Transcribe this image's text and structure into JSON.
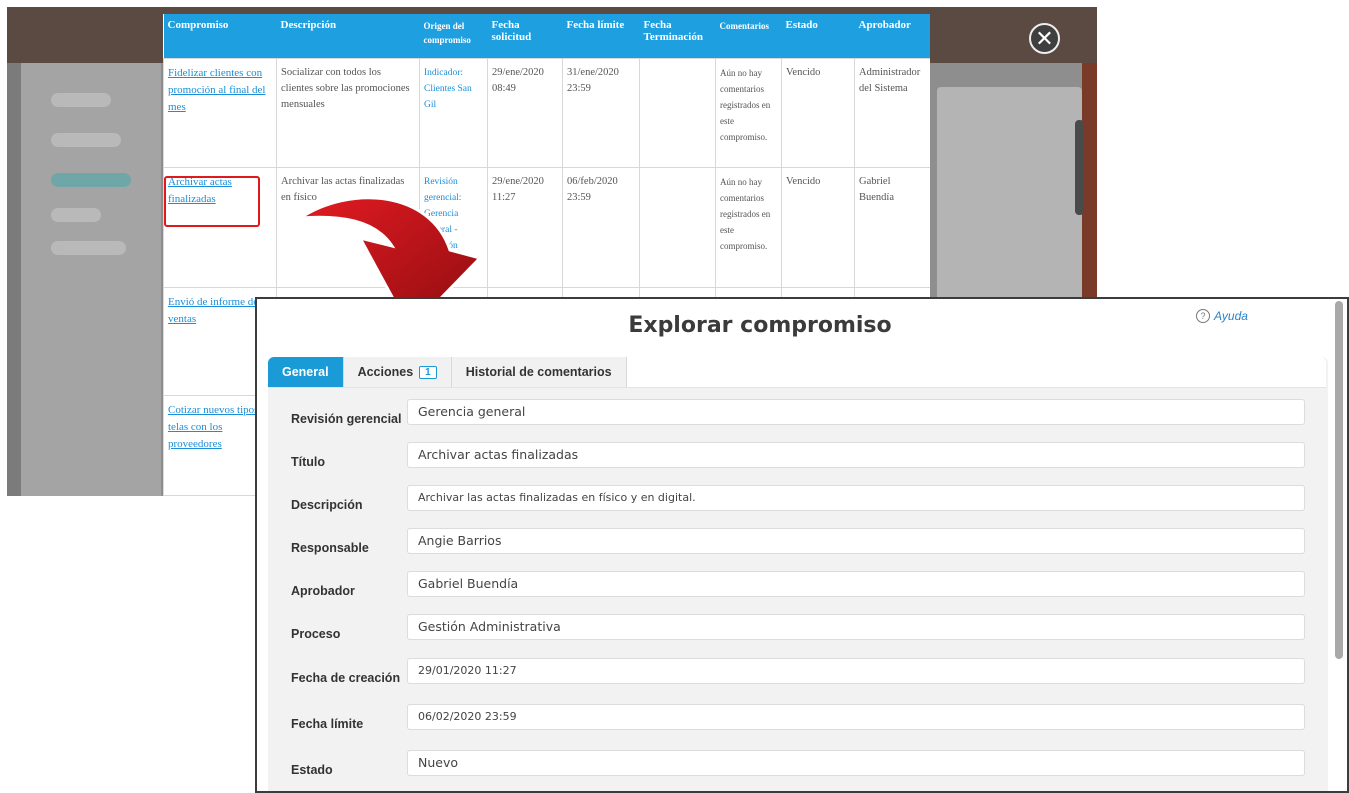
{
  "table": {
    "headers": [
      "Compromiso",
      "Descripción",
      "Origen del compromiso",
      "Fecha solicitud",
      "Fecha límite",
      "Fecha Terminación",
      "Comentarios",
      "Estado",
      "Aprobador"
    ],
    "rows": [
      {
        "compromiso": "Fidelizar clientes con promoción al final del mes",
        "descripcion": "Socializar con todos los clientes sobre las promociones mensuales",
        "origen": "Indicador: Clientes San Gil",
        "fecha_solicitud": "29/ene/2020 08:49",
        "fecha_limite": "31/ene/2020 23:59",
        "fecha_terminacion": "",
        "comentarios": "Aún no hay comentarios registrados en este compromiso.",
        "estado": "Vencido",
        "aprobador": "Administrador del Sistema"
      },
      {
        "compromiso": "Archivar actas finalizadas",
        "descripcion": "Archivar las actas finalizadas en físico",
        "origen": "Revisión gerencial: Gerencia general - Revisión Estratégica",
        "fecha_solicitud": "29/ene/2020 11:27",
        "fecha_limite": "06/feb/2020 23:59",
        "fecha_terminacion": "",
        "comentarios": "Aún no hay comentarios registrados en este compromiso.",
        "estado": "Vencido",
        "aprobador": "Gabriel Buendía"
      },
      {
        "compromiso": "Envió de informe de ventas",
        "descripcion": "",
        "origen": "",
        "fecha_solicitud": "",
        "fecha_limite": "",
        "fecha_terminacion": "",
        "comentarios": "",
        "estado": "",
        "aprobador": ""
      },
      {
        "compromiso": "Cotizar nuevos tipos de telas con los proveedores",
        "descripcion": "",
        "origen": "",
        "fecha_solicitud": "",
        "fecha_limite": "",
        "fecha_terminacion": "",
        "comentarios": "",
        "estado": "",
        "aprobador": ""
      }
    ]
  },
  "dialog": {
    "title": "Explorar compromiso",
    "help": "Ayuda",
    "tabs": {
      "general": "General",
      "acciones": "Acciones",
      "acciones_count": "1",
      "historial": "Historial de comentarios"
    },
    "fields": [
      {
        "label": "Revisión gerencial",
        "value": "Gerencia general"
      },
      {
        "label": "Título",
        "value": "Archivar actas finalizadas"
      },
      {
        "label": "Descripción",
        "value": "Archivar las actas finalizadas en físico y en digital."
      },
      {
        "label": "Responsable",
        "value": "Angie Barrios"
      },
      {
        "label": "Aprobador",
        "value": "Gabriel Buendía"
      },
      {
        "label": "Proceso",
        "value": "Gestión Administrativa"
      },
      {
        "label": "Fecha de creación",
        "value": "29/01/2020 11:27"
      },
      {
        "label": "Fecha límite",
        "value": "06/02/2020 23:59"
      },
      {
        "label": "Estado",
        "value": "Nuevo"
      }
    ]
  },
  "colors": {
    "accent": "#1b9ad8",
    "highlight": "#e01a1a",
    "arrow": "#c0141a"
  },
  "icons": {
    "close": "close-icon",
    "help": "help-circle-icon"
  }
}
